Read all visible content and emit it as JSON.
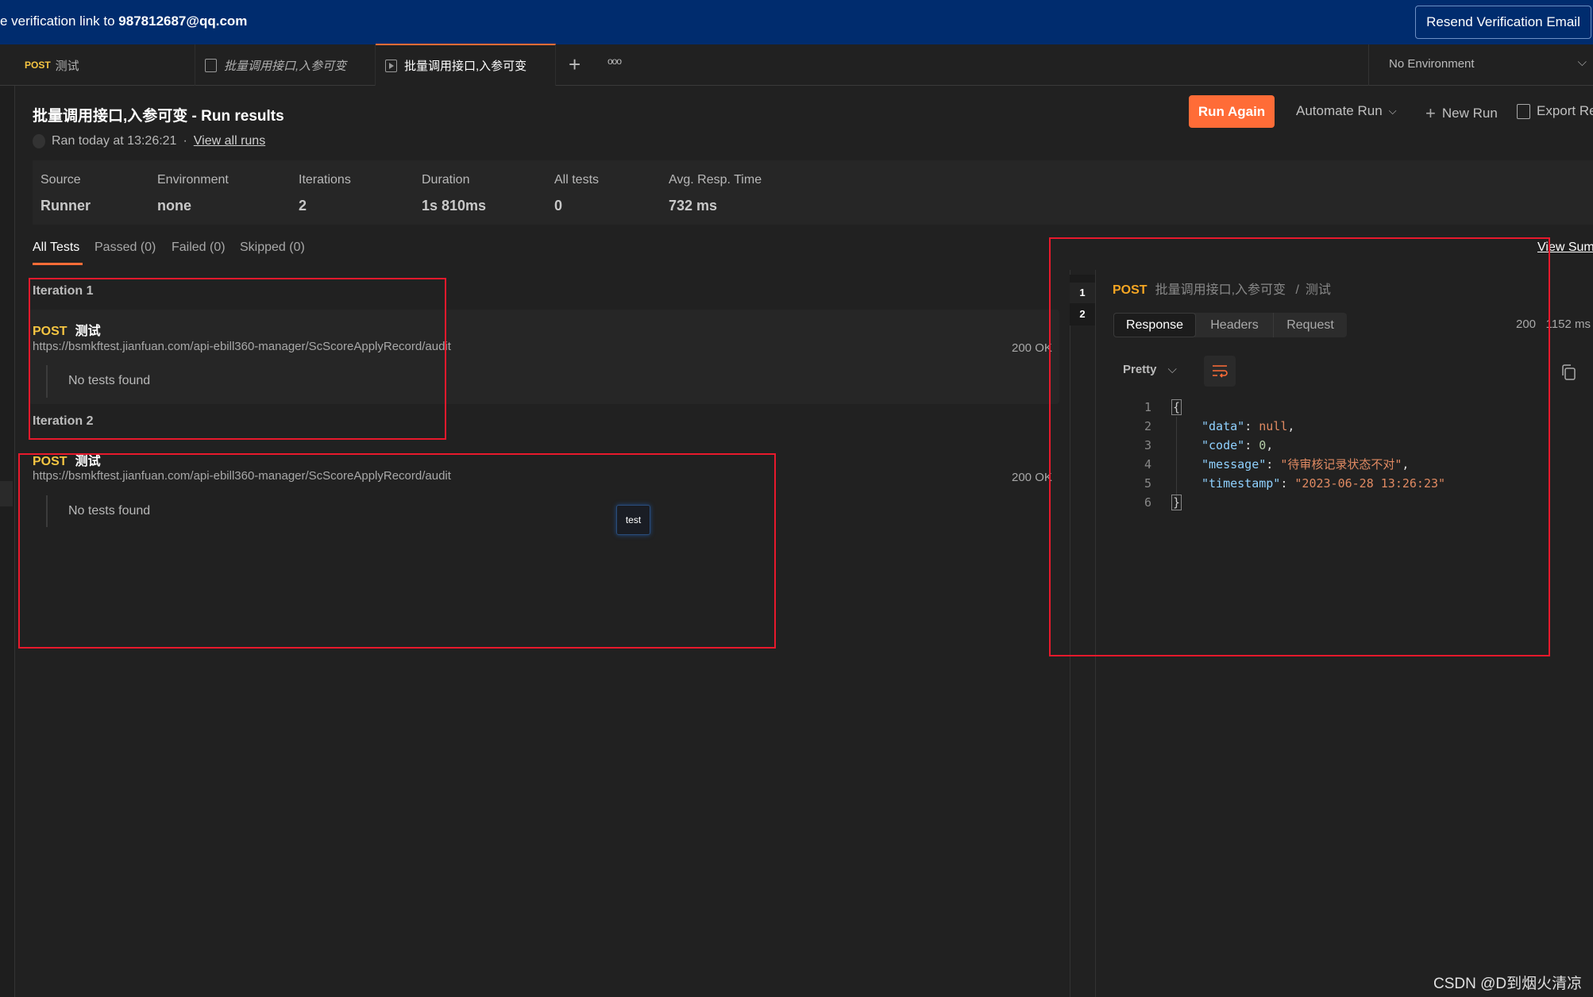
{
  "banner": {
    "text_prefix": "e verification link to ",
    "email": "987812687@qq.com",
    "resend_label": "Resend Verification Email",
    "color": "#002c6e"
  },
  "tabs": [
    {
      "method": "POST",
      "label": "测试"
    },
    {
      "label": "批量调用接口,入参可变",
      "icon": "collection-icon"
    },
    {
      "label": "批量调用接口,入参可变",
      "icon": "runner-icon",
      "active": true
    }
  ],
  "tabbar": {
    "add": "+",
    "more": "ooo",
    "environment": "No Environment"
  },
  "header": {
    "title": "批量调用接口,入参可变 - Run results",
    "ran": "Ran today at 13:26:21",
    "sep": "·",
    "view_all": "View all runs"
  },
  "toolbar": {
    "run_again": "Run Again",
    "automate": "Automate Run",
    "new_run": "New Run",
    "export": "Export Re"
  },
  "summary": [
    {
      "label": "Source",
      "value": "Runner"
    },
    {
      "label": "Environment",
      "value": "none"
    },
    {
      "label": "Iterations",
      "value": "2"
    },
    {
      "label": "Duration",
      "value": "1s 810ms"
    },
    {
      "label": "All tests",
      "value": "0"
    },
    {
      "label": "Avg. Resp. Time",
      "value": "732 ms"
    }
  ],
  "filters": [
    "All Tests",
    "Passed (0)",
    "Failed (0)",
    "Skipped (0)"
  ],
  "iterations": [
    {
      "label": "Iteration 1",
      "method": "POST",
      "name": "测试",
      "url": "https://bsmkftest.jianfuan.com/api-ebill360-manager/ScScoreApplyRecord/audit",
      "status": "200 OK",
      "tests": "No tests found"
    },
    {
      "label": "Iteration 2",
      "method": "POST",
      "name": "测试",
      "url": "https://bsmkftest.jianfuan.com/api-ebill360-manager/ScScoreApplyRecord/audit",
      "status": "200 OK",
      "tests": "No tests found"
    }
  ],
  "tooltip": "test",
  "detail": {
    "view_summary": "View Sum",
    "iteration_numbers": [
      "1",
      "2"
    ],
    "method": "POST",
    "collection": "批量调用接口,入参可变",
    "slash": "/",
    "request": "测试",
    "tabs": [
      "Response",
      "Headers",
      "Request"
    ],
    "status": "200",
    "time": "1152 ms",
    "format": "Pretty",
    "lines": [
      "1",
      "2",
      "3",
      "4",
      "5",
      "6"
    ],
    "json": {
      "open": "{",
      "close": "}",
      "k1": "\"data\"",
      "v1": "null",
      "k2": "\"code\"",
      "v2": "0",
      "k3": "\"message\"",
      "v3": "\"待审核记录状态不对\"",
      "k4": "\"timestamp\"",
      "v4": "\"2023-06-28 13:26:23\""
    }
  },
  "watermark": "CSDN @D到烟火清凉",
  "colors": {
    "accent": "#ff6c37",
    "post": "#f5c542",
    "annotation": "#e8192c"
  }
}
